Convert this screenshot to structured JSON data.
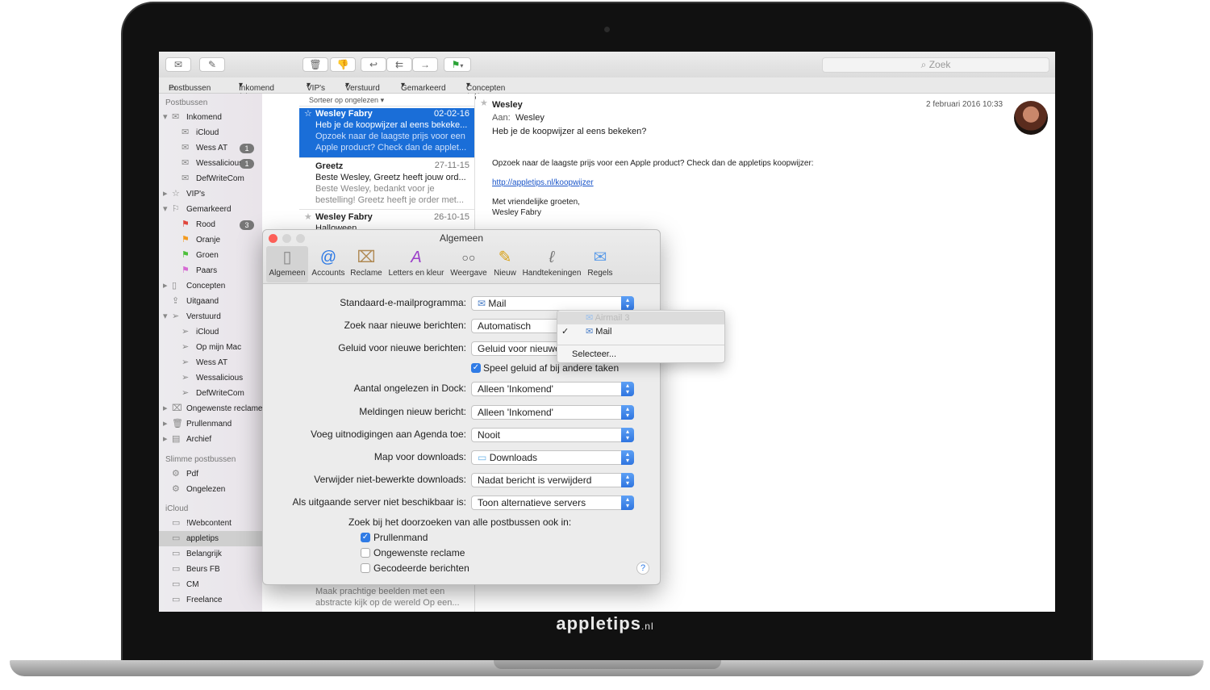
{
  "brand": {
    "name": "appletips",
    "tld": ".nl"
  },
  "toolbar": {
    "search_placeholder": "Zoek"
  },
  "favorites": [
    "Postbussen",
    "Inkomend (2)",
    "VIP's",
    "Verstuurd",
    "Gemarkeerd",
    "Concepten (17)"
  ],
  "sidebar": {
    "header_mailboxes": "Postbussen",
    "items": [
      {
        "label": "Inkomend"
      },
      {
        "label": "iCloud"
      },
      {
        "label": "Wess AT",
        "badge": "1"
      },
      {
        "label": "Wessalicious",
        "badge": "1"
      },
      {
        "label": "DefWriteCom"
      },
      {
        "label": "VIP's"
      },
      {
        "label": "Gemarkeerd"
      },
      {
        "label": "Rood",
        "badge": "3"
      },
      {
        "label": "Oranje"
      },
      {
        "label": "Groen"
      },
      {
        "label": "Paars"
      },
      {
        "label": "Concepten"
      },
      {
        "label": "Uitgaand"
      },
      {
        "label": "Verstuurd"
      },
      {
        "label": "iCloud"
      },
      {
        "label": "Op mijn Mac"
      },
      {
        "label": "Wess AT"
      },
      {
        "label": "Wessalicious"
      },
      {
        "label": "DefWriteCom"
      },
      {
        "label": "Ongewenste reclame"
      },
      {
        "label": "Prullenmand"
      },
      {
        "label": "Archief"
      }
    ],
    "header_smart": "Slimme postbussen",
    "smart": [
      {
        "label": "Pdf"
      },
      {
        "label": "Ongelezen"
      }
    ],
    "header_icloud": "iCloud",
    "icloud": [
      {
        "label": "!Webcontent"
      },
      {
        "label": "appletips"
      },
      {
        "label": "Belangrijk"
      },
      {
        "label": "Beurs FB"
      },
      {
        "label": "CM"
      },
      {
        "label": "Freelance"
      }
    ]
  },
  "message_list": {
    "sort_label": "Sorteer op ongelezen",
    "messages": [
      {
        "from": "Wesley Fabry",
        "date": "02-02-16",
        "subject": "Heb je de koopwijzer al eens bekeke...",
        "preview1": "Opzoek naar de laagste prijs voor een",
        "preview2": "Apple product? Check dan de applet..."
      },
      {
        "from": "Greetz",
        "date": "27-11-15",
        "subject": "Beste Wesley, Greetz heeft jouw ord...",
        "preview1": "Beste Wesley, bedankt voor je",
        "preview2": "bestelling! Greetz heeft je order met..."
      },
      {
        "from": "Wesley Fabry",
        "date": "26-10-15",
        "subject": "Halloween"
      }
    ],
    "bottom_preview1": "Maak prachtige beelden met een",
    "bottom_preview2": "abstracte kijk op de wereld Op een..."
  },
  "reader": {
    "from": "Wesley",
    "to_label": "Aan:",
    "to": "Wesley",
    "date": "2 februari 2016 10:33",
    "subject": "Heb je de koopwijzer al eens bekeken?",
    "body1": "Opzoek naar de laagste prijs voor een Apple product? Check dan de appletips koopwijzer:",
    "link": "http://appletips.nl/koopwijzer",
    "sign1": "Met vriendelijke groeten,",
    "sign2": "Wesley Fabry"
  },
  "prefs": {
    "title": "Algemeen",
    "tabs": [
      {
        "label": "Algemeen",
        "icon": "switch-icon"
      },
      {
        "label": "Accounts",
        "icon": "at-icon"
      },
      {
        "label": "Reclame",
        "icon": "trash-junk-icon"
      },
      {
        "label": "Letters en kleur",
        "icon": "font-color-icon"
      },
      {
        "label": "Weergave",
        "icon": "glasses-icon"
      },
      {
        "label": "Nieuw",
        "icon": "pencil-icon"
      },
      {
        "label": "Handtekeningen",
        "icon": "signature-icon"
      },
      {
        "label": "Regels",
        "icon": "rules-envelope-icon"
      }
    ],
    "rows": {
      "default_mail_label": "Standaard-e-mailprogramma:",
      "default_mail_value": "Mail",
      "check_label": "Zoek naar nieuwe berichten:",
      "check_value": "Automatisch",
      "sound_label": "Geluid voor nieuwe berichten:",
      "sound_value": "Geluid voor nieuwe",
      "play_sound_label": "Speel geluid af bij andere taken",
      "dock_label": "Aantal ongelezen in Dock:",
      "dock_value": "Alleen 'Inkomend'",
      "notif_label": "Meldingen nieuw bericht:",
      "notif_value": "Alleen 'Inkomend'",
      "invites_label": "Voeg uitnodigingen aan Agenda toe:",
      "invites_value": "Nooit",
      "downloads_label": "Map voor downloads:",
      "downloads_value": "Downloads",
      "remove_label": "Verwijder niet-bewerkte downloads:",
      "remove_value": "Nadat bericht is verwijderd",
      "server_label": "Als uitgaande server niet beschikbaar is:",
      "server_value": "Toon alternatieve servers",
      "search_label": "Zoek bij het doorzoeken van alle postbussen ook in:",
      "opt_trash": "Prullenmand",
      "opt_junk": "Ongewenste reclame",
      "opt_encrypted": "Gecodeerde berichten",
      "help": "?"
    }
  },
  "dropdown": {
    "items": [
      {
        "label": "Airmail 3",
        "disabled": true
      },
      {
        "label": "Mail",
        "checked": "✓"
      },
      {
        "label": "Selecteer..."
      }
    ]
  },
  "colors": {
    "accent": "#2f7be5",
    "selection": "#1a6ed8",
    "close": "#fc5f57"
  }
}
